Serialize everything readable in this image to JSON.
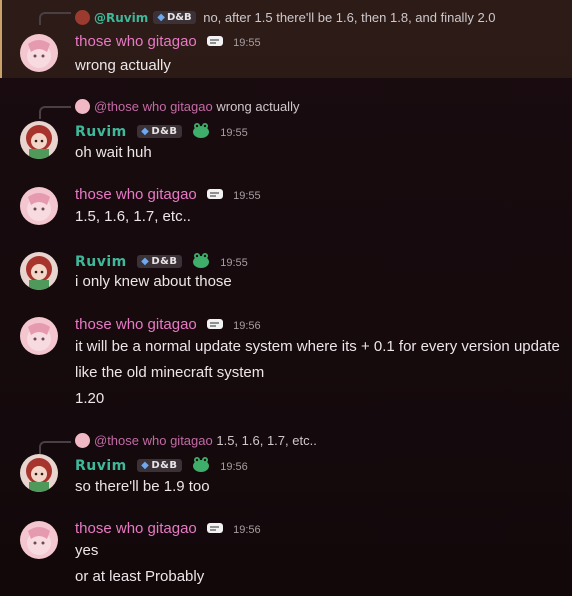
{
  "users": {
    "gita": "those who gitagao",
    "ruvim": "Ruvim"
  },
  "role_tag": "D&B",
  "messages": [
    {
      "reply": {
        "author": "@Ruvim",
        "tag": "D&B",
        "text": "no, after 1.5 there'll be 1.6, then 1.8, and finally 2.0"
      },
      "author": "those who gitagao",
      "time": "19:55",
      "lines": [
        "wrong actually"
      ]
    },
    {
      "reply": {
        "author": "@those who gitagao",
        "text": "wrong actually"
      },
      "author": "Ruvim",
      "time": "19:55",
      "lines": [
        "oh wait huh"
      ]
    },
    {
      "author": "those who gitagao",
      "time": "19:55",
      "lines": [
        "1.5, 1.6, 1.7, etc.."
      ]
    },
    {
      "author": "Ruvim",
      "time": "19:55",
      "lines": [
        "i only knew about those"
      ]
    },
    {
      "author": "those who gitagao",
      "time": "19:56",
      "lines": [
        "it will be a normal update system where its + 0.1 for every version update",
        "like the old minecraft system",
        "1.20"
      ]
    },
    {
      "reply": {
        "author": "@those who gitagao",
        "text": "1.5, 1.6, 1.7, etc.."
      },
      "author": "Ruvim",
      "time": "19:56",
      "lines": [
        "so there'll be 1.9 too"
      ]
    },
    {
      "author": "those who gitagao",
      "time": "19:56",
      "lines": [
        "yes",
        "or at least Probably"
      ]
    }
  ],
  "colors": {
    "gita": "#e879c4",
    "ruvim": "#3fb89a",
    "highlight": "#c9a26a"
  },
  "icons": {
    "gita_badge": "cloud-sticker-icon",
    "ruvim_badge": "frog-icon",
    "role": "diamond-icon"
  }
}
